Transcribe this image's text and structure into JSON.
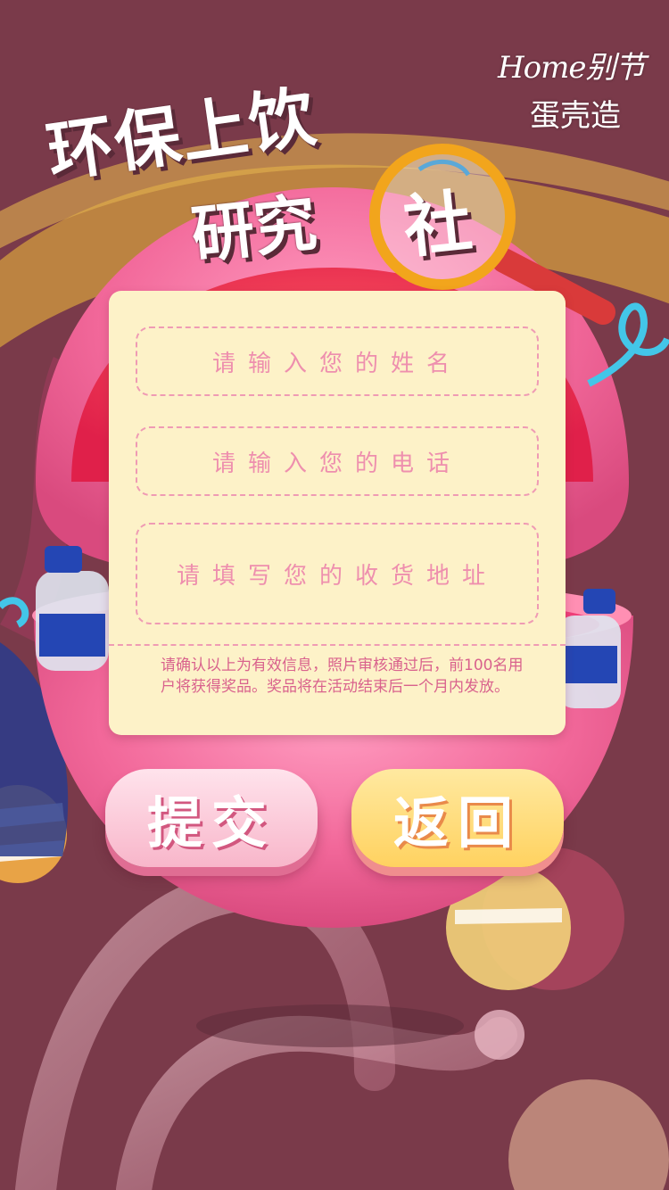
{
  "colors": {
    "background": "#7a3a4a",
    "capsule_pink": "#f2689a",
    "card": "#fdf2c8",
    "field_border": "#ef9bb4",
    "placeholder_text": "#ee8fae",
    "notice_text": "#d9628d",
    "submit_button": "#f8b6ca",
    "back_button": "#ffd260"
  },
  "logo": {
    "line1": "Home别节",
    "line2": "蛋壳造"
  },
  "title": {
    "line1": "环保上饮",
    "line2": "研究",
    "magnified_char": "社"
  },
  "form": {
    "name_placeholder": "请输入您的姓名",
    "phone_placeholder": "请输入您的电话",
    "address_placeholder": "请填写您的收货地址",
    "notice": "请确认以上为有效信息，照片审核通过后，前100名用户将获得奖品。奖品将在活动结束后一个月内发放。"
  },
  "buttons": {
    "submit_label": "提交",
    "back_label": "返回"
  },
  "icons": {
    "magnifier": "magnifying-glass-icon",
    "bottle": "water-bottle-icon"
  }
}
